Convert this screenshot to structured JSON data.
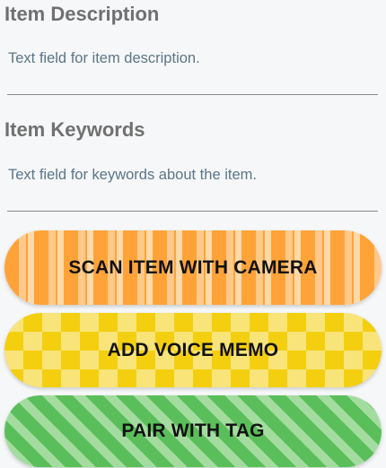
{
  "description": {
    "title": "Item Description",
    "placeholder": "Text field for item description."
  },
  "keywords": {
    "title": "Item Keywords",
    "placeholder": "Text field for keywords about the item."
  },
  "actions": {
    "scan_label": "SCAN ITEM WITH CAMERA",
    "voice_label": "ADD VOICE MEMO",
    "tag_label": "PAIR WITH TAG"
  },
  "colors": {
    "scan_primary": "#ffa338",
    "scan_secondary": "#ffd9a8",
    "voice_primary": "#f3cf10",
    "voice_secondary": "#f8e479",
    "tag_primary": "#5abf5a",
    "tag_secondary": "#a4dca0",
    "title_text": "#707070",
    "placeholder_text": "#5a7686"
  }
}
